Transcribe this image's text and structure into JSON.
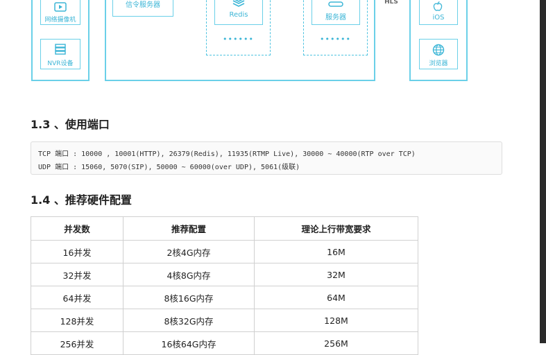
{
  "diagram": {
    "labels": {
      "camera": "网络摄像机",
      "nvr": "NVR设备",
      "signal_server": "信令服务器",
      "redis": "Redis",
      "server": "服务器",
      "hls": "HLS",
      "ios": "iOS",
      "browser": "浏览器"
    },
    "dots": "••••••"
  },
  "section_13": {
    "title": "1.3 、使用端口",
    "code_lines": [
      "TCP 端口 : 10000 , 10001(HTTP), 26379(Redis), 11935(RTMP Live), 30000 ~ 40000(RTP over TCP)",
      "UDP 端口 : 15060, 5070(SIP), 50000 ~ 60000(over UDP), 5061(级联)"
    ]
  },
  "section_14": {
    "title": "1.4 、推荐硬件配置",
    "table": {
      "headers": [
        "并发数",
        "推荐配置",
        "理论上行带宽要求"
      ],
      "rows": [
        [
          "16并发",
          "2核4G内存",
          "16M"
        ],
        [
          "32并发",
          "4核8G内存",
          "32M"
        ],
        [
          "64并发",
          "8核16G内存",
          "64M"
        ],
        [
          "128并发",
          "8核32G内存",
          "128M"
        ],
        [
          "256并发",
          "16核64G内存",
          "256M"
        ]
      ]
    }
  },
  "colors": {
    "diagram_accent": "#3bb5d6",
    "diagram_border": "#6ad0e8"
  }
}
